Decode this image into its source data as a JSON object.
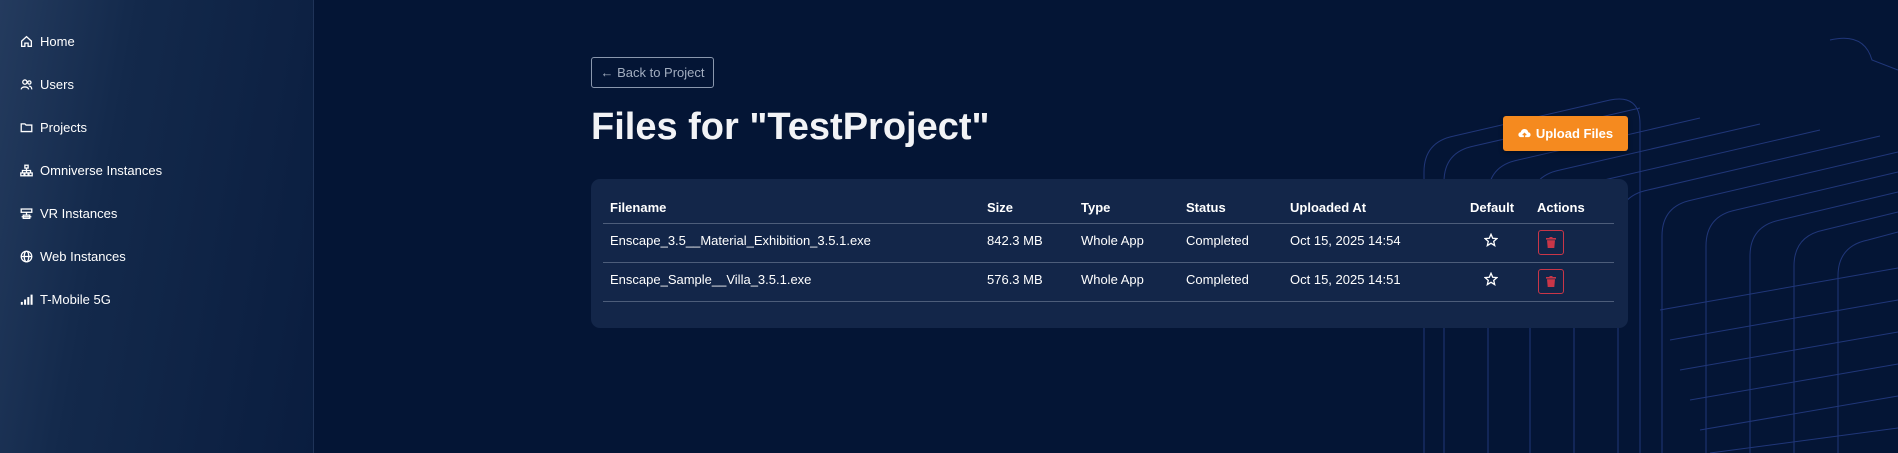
{
  "sidebar": {
    "items": [
      {
        "label": "Home",
        "icon": "home-icon"
      },
      {
        "label": "Users",
        "icon": "users-icon"
      },
      {
        "label": "Projects",
        "icon": "folder-icon"
      },
      {
        "label": "Omniverse Instances",
        "icon": "network-icon"
      },
      {
        "label": "VR Instances",
        "icon": "server-icon"
      },
      {
        "label": "Web Instances",
        "icon": "globe-icon"
      },
      {
        "label": "T-Mobile 5G",
        "icon": "signal-icon"
      }
    ]
  },
  "header": {
    "back_label": "← Back to Project",
    "title": "Files for \"TestProject\"",
    "upload_label": "Upload Files"
  },
  "table": {
    "columns": [
      "Filename",
      "Size",
      "Type",
      "Status",
      "Uploaded At",
      "Default",
      "Actions"
    ],
    "rows": [
      {
        "filename": "Enscape_3.5__Material_Exhibition_3.5.1.exe",
        "size": "842.3 MB",
        "type": "Whole App",
        "status": "Completed",
        "uploaded_at": "Oct 15, 2025 14:54"
      },
      {
        "filename": "Enscape_Sample__Villa_3.5.1.exe",
        "size": "576.3 MB",
        "type": "Whole App",
        "status": "Completed",
        "uploaded_at": "Oct 15, 2025 14:51"
      }
    ]
  },
  "colors": {
    "background": "#041535",
    "card": "#132649",
    "accent_orange": "#f58a1f",
    "danger": "#c93648"
  }
}
